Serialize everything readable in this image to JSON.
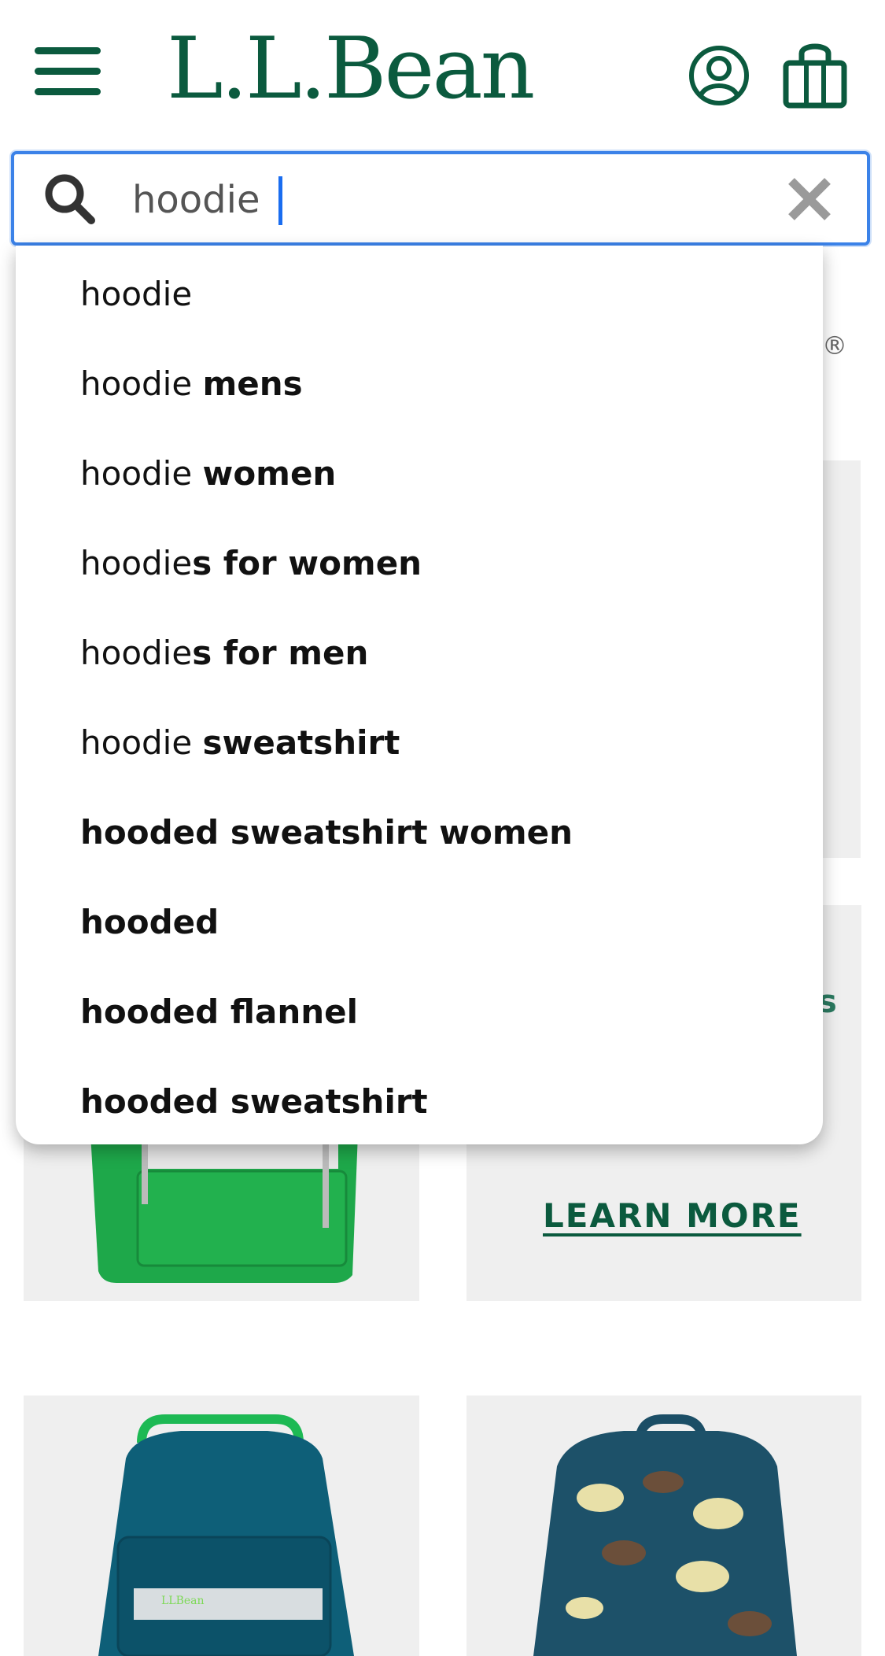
{
  "header": {
    "logo_text": "L.L.Bean"
  },
  "search": {
    "value": "hoodie",
    "placeholder": ""
  },
  "suggestions": [
    {
      "prefix": "hoodie",
      "completion": ""
    },
    {
      "prefix": "hoodie ",
      "completion": "mens"
    },
    {
      "prefix": "hoodie ",
      "completion": "women"
    },
    {
      "prefix": "hoodie",
      "completion": "s for women"
    },
    {
      "prefix": "hoodie",
      "completion": "s for men"
    },
    {
      "prefix": "hoodie ",
      "completion": "sweatshirt"
    },
    {
      "prefix": "",
      "completion": "hooded sweatshirt women"
    },
    {
      "prefix": "",
      "completion": "hooded"
    },
    {
      "prefix": "",
      "completion": "hooded flannel"
    },
    {
      "prefix": "",
      "completion": "hooded sweatshirt"
    }
  ],
  "background": {
    "trademark": "®",
    "peek_text": "s",
    "learn_more": "LEARN MORE"
  },
  "colors": {
    "brand_green": "#0b5a3e",
    "focus_blue": "#3b82e8",
    "tile_gray": "#efefef"
  }
}
